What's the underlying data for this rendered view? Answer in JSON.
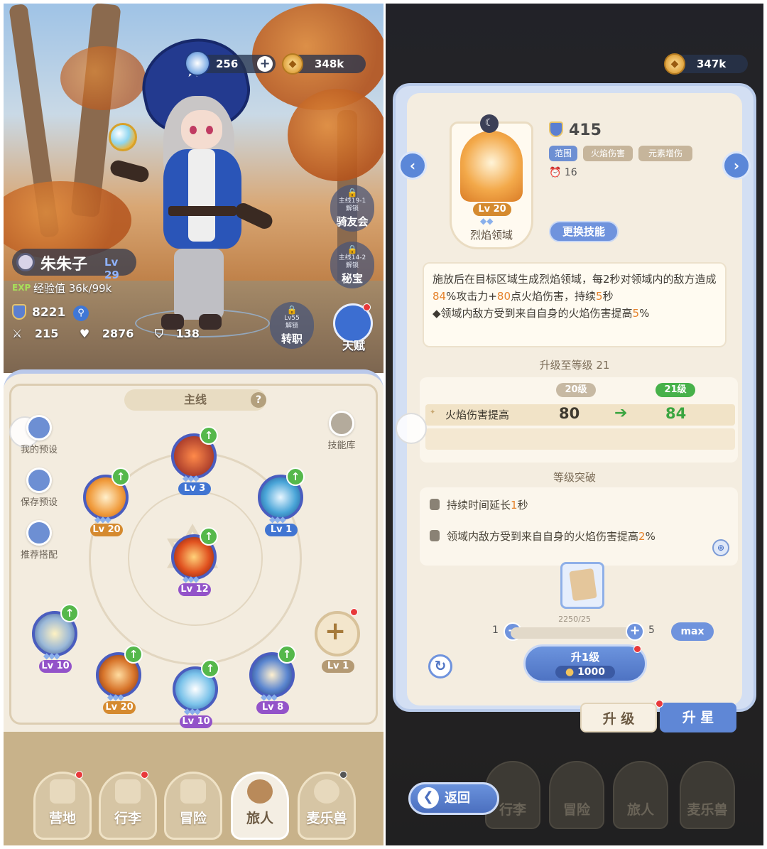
{
  "left": {
    "resources": {
      "gems": "256",
      "coins": "348k"
    },
    "character": {
      "name": "朱朱子",
      "level": "Lv 29",
      "exp_tag": "EXP",
      "exp": "经验值 36k/99k",
      "power": "8221",
      "attack": "215",
      "hp": "2876",
      "defense": "138"
    },
    "side_buttons": [
      {
        "req": "主线19-1",
        "lock": "解锁",
        "title": "骑友会"
      },
      {
        "req": "主线14-2",
        "lock": "解锁",
        "title": "秘宝"
      },
      {
        "req": "Lv55",
        "lock": "解锁",
        "title": "转职"
      }
    ],
    "talent_label": "天赋",
    "board": {
      "tab": "主线",
      "help": "?",
      "actions": [
        "我的预设",
        "保存预设",
        "推荐搭配"
      ],
      "skill_library": "技能库",
      "skills": [
        {
          "lv": "Lv 3",
          "color": "#4175d2"
        },
        {
          "lv": "Lv 20",
          "color": "#d58a2f"
        },
        {
          "lv": "Lv 1",
          "color": "#4175d2"
        },
        {
          "lv": "Lv 12",
          "color": "#9353c9"
        },
        {
          "lv": "Lv 10",
          "color": "#9353c9"
        },
        {
          "lv": "Lv 20",
          "color": "#d58a2f"
        },
        {
          "lv": "Lv 10",
          "color": "#9353c9"
        },
        {
          "lv": "Lv 8",
          "color": "#9353c9"
        },
        {
          "lv": "Lv 1",
          "color": "#b49a74"
        }
      ]
    },
    "nav": [
      "营地",
      "行李",
      "冒险",
      "旅人",
      "麦乐兽"
    ]
  },
  "right": {
    "coins": "347k",
    "skill": {
      "lv": "Lv 20",
      "name": "烈焰领域",
      "power": "415",
      "tags": [
        "范围",
        "火焰伤害",
        "元素增伤"
      ],
      "cooldown": "16",
      "change_button": "更换技能",
      "description_parts": [
        "施放后在目标区域生成烈焰领域，每2秒对领域内的敌方造成",
        "84",
        "%攻击力+",
        "80",
        "点火焰伤害，持续",
        "5",
        "秒"
      ],
      "description_line3_parts": [
        "◆领域内敌方受到来自自身的火焰伤害提高",
        "5",
        "%"
      ]
    },
    "upgrade": {
      "title": "升级至等级 21",
      "from_level": "20级",
      "to_level": "21级",
      "stat_name": "火焰伤害提高",
      "from_value": "80",
      "to_value": "84"
    },
    "breakthrough": {
      "title": "等级突破",
      "items": [
        {
          "pre": "持续时间延长",
          "num": "1",
          "post": "秒"
        },
        {
          "pre": "领域内敌方受到来自自身的火焰伤害提高",
          "num": "2",
          "post": "%"
        }
      ]
    },
    "material_count": "2250/25",
    "qty_min": "1",
    "qty_max": "5",
    "max_label": "max",
    "upgrade_button": {
      "label": "升1级",
      "cost": "1000"
    },
    "tabs": {
      "upgrade": "升 级",
      "star": "升 星"
    },
    "back": "返回",
    "nav": [
      "行李",
      "冒险",
      "旅人",
      "麦乐兽"
    ]
  }
}
